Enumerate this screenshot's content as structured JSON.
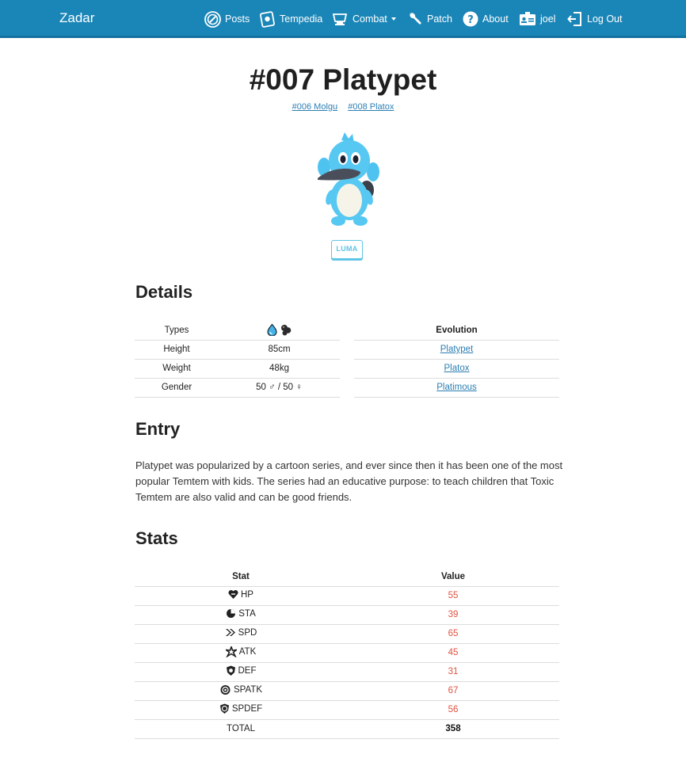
{
  "nav": {
    "brand": "Zadar",
    "items": [
      {
        "label": "Posts",
        "icon": "posts-icon"
      },
      {
        "label": "Tempedia",
        "icon": "tempedia-icon"
      },
      {
        "label": "Combat",
        "icon": "combat-icon"
      },
      {
        "label": "Patch",
        "icon": "wrench-icon"
      },
      {
        "label": "About",
        "icon": "question-icon"
      },
      {
        "label": "joel",
        "icon": "id-card-icon"
      },
      {
        "label": "Log Out",
        "icon": "logout-icon"
      }
    ]
  },
  "temtem": {
    "title": "#007 Platypet",
    "prev": "#006 Molgu",
    "next": "#008 Platox",
    "badge": "LUMA"
  },
  "details": {
    "heading": "Details",
    "rows": [
      {
        "label": "Types",
        "value": ""
      },
      {
        "label": "Height",
        "value": "85cm"
      },
      {
        "label": "Weight",
        "value": "48kg"
      },
      {
        "label": "Gender",
        "value": "50 ♂ / 50 ♀"
      }
    ],
    "types": [
      "water-type-icon",
      "toxic-type-icon"
    ],
    "evolution_header": "Evolution",
    "evolution": [
      "Platypet",
      "Platox",
      "Platimous"
    ]
  },
  "entry": {
    "heading": "Entry",
    "text": "Platypet was popularized by a cartoon series, and ever since then it has been one of the most popular Temtem with kids. The series had an educative purpose: to teach children that Toxic Temtem are also valid and can be good friends."
  },
  "stats": {
    "heading": "Stats",
    "col_stat": "Stat",
    "col_value": "Value",
    "rows": [
      {
        "name": "HP",
        "value": "55"
      },
      {
        "name": "STA",
        "value": "39"
      },
      {
        "name": "SPD",
        "value": "65"
      },
      {
        "name": "ATK",
        "value": "45"
      },
      {
        "name": "DEF",
        "value": "31"
      },
      {
        "name": "SPATK",
        "value": "67"
      },
      {
        "name": "SPDEF",
        "value": "56"
      }
    ],
    "total_label": "TOTAL",
    "total_value": "358"
  },
  "colors": {
    "navbar": "#1a86b8",
    "link": "#2c7fb3",
    "stat_value": "#e0523f",
    "luma": "#5fc4e6"
  }
}
